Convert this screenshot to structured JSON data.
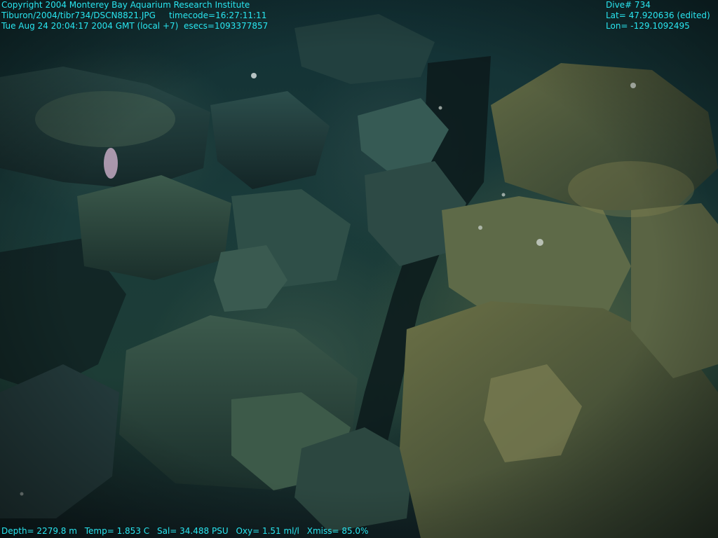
{
  "header_left": {
    "copyright": "Copyright 2004 Monterey Bay Aquarium Research Institute",
    "file_line": "Tiburon/2004/tibr734/DSCN8821.JPG     timecode=16:27:11:11",
    "date_line": "Tue Aug 24 20:04:17 2004 GMT (local +7)  esecs=1093377857"
  },
  "header_right": {
    "dive": "Dive# 734",
    "lat": "Lat= 47.920636 (edited)",
    "lon": "Lon= -129.1092495"
  },
  "footer": {
    "depth": "Depth= 2279.8 m",
    "temp": "Temp= 1.853 C",
    "sal": "Sal= 34.488 PSU",
    "oxy": "Oxy= 1.51 ml/l",
    "xmiss": "Xmiss= 85.0%"
  }
}
